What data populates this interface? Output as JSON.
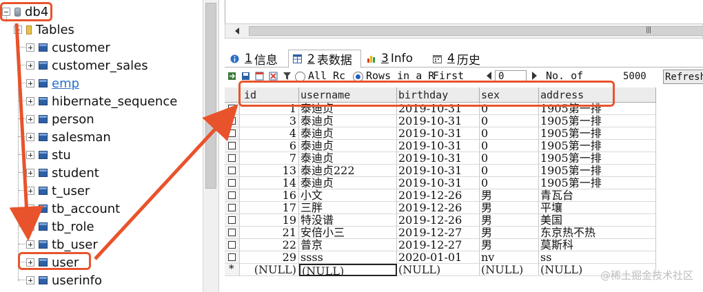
{
  "tree": {
    "database": "db4",
    "folder": "Tables",
    "tables": [
      {
        "label": "customer",
        "link": false
      },
      {
        "label": "customer_sales",
        "link": false
      },
      {
        "label": "emp",
        "link": true
      },
      {
        "label": "hibernate_sequence",
        "link": false
      },
      {
        "label": "person",
        "link": false
      },
      {
        "label": "salesman",
        "link": false
      },
      {
        "label": "stu",
        "link": false
      },
      {
        "label": "student",
        "link": false
      },
      {
        "label": "t_user",
        "link": false
      },
      {
        "label": "tb_account",
        "link": false
      },
      {
        "label": "tb_role",
        "link": false
      },
      {
        "label": "tb_user",
        "link": false
      },
      {
        "label": "user",
        "link": false
      },
      {
        "label": "userinfo",
        "link": false
      }
    ]
  },
  "tabs": [
    {
      "num": "1",
      "label": "信息",
      "icon": "info-icon"
    },
    {
      "num": "2",
      "label": "表数据",
      "icon": "table-data-icon",
      "active": true
    },
    {
      "num": "3",
      "label": "Info",
      "icon": "chart-icon"
    },
    {
      "num": "4",
      "label": "历史",
      "icon": "calendar-icon"
    }
  ],
  "toolbar": {
    "all_rows_label": "All Rc",
    "rows_in_range_label": "Rows in a R",
    "first_label": "First",
    "first_value": "0",
    "no_of_label": "No. of",
    "rows_value": "5000",
    "refresh_label": "Refresh"
  },
  "grid": {
    "columns": [
      "id",
      "username",
      "birthday",
      "sex",
      "address"
    ],
    "rows": [
      [
        "1",
        "泰迪贞",
        "2019-10-31",
        "0",
        "1905第一排"
      ],
      [
        "3",
        "泰迪贞",
        "2019-10-31",
        "0",
        "1905第一排"
      ],
      [
        "4",
        "泰迪贞",
        "2019-10-31",
        "0",
        "1905第一排"
      ],
      [
        "6",
        "泰迪贞",
        "2019-10-31",
        "0",
        "1905第一排"
      ],
      [
        "7",
        "泰迪贞",
        "2019-10-31",
        "0",
        "1905第一排"
      ],
      [
        "13",
        "泰迪贞222",
        "2019-10-31",
        "0",
        "1905第一排"
      ],
      [
        "14",
        "泰迪贞",
        "2019-10-31",
        "0",
        "1905第一排"
      ],
      [
        "16",
        "小文",
        "2019-12-26",
        "男",
        "青瓦台"
      ],
      [
        "17",
        "三胖",
        "2019-12-26",
        "男",
        "平壤"
      ],
      [
        "19",
        "特没谱",
        "2019-12-26",
        "男",
        "美国"
      ],
      [
        "21",
        "安倍小三",
        "2019-12-27",
        "男",
        "东京热不热"
      ],
      [
        "22",
        "普京",
        "2019-12-27",
        "男",
        "莫斯科"
      ],
      [
        "29",
        "ssss",
        "2020-01-01",
        "nv",
        "ss"
      ]
    ],
    "new_row_marker": "*",
    "null_text": "(NULL)"
  },
  "annotation_color": "#e8532b",
  "watermark": "@稀土掘金技术社区"
}
